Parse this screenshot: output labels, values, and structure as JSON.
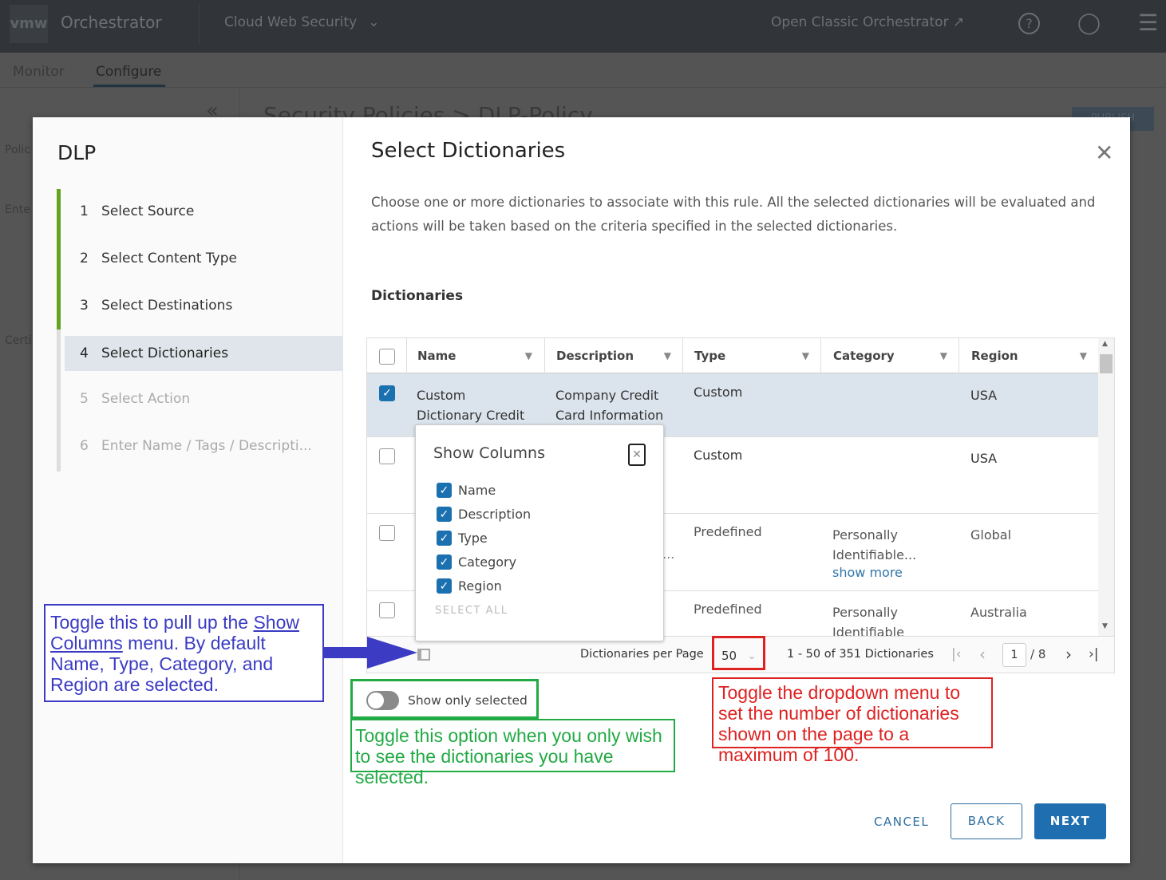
{
  "topbar": {
    "logo": "vmw",
    "app": "Orchestrator",
    "product": "Cloud Web Security",
    "classic": "Open Classic Orchestrator"
  },
  "subnav": {
    "tabs": [
      "Monitor",
      "Configure"
    ],
    "active": "Configure"
  },
  "background": {
    "breadcrumb": "Security Policies > DLP-Policy",
    "publish": "PUBLISH",
    "side_labels": [
      "Polic",
      "Ente",
      "Certi"
    ]
  },
  "wizard": {
    "title": "DLP",
    "steps": [
      {
        "num": "1",
        "label": "Select Source",
        "state": "done"
      },
      {
        "num": "2",
        "label": "Select Content Type",
        "state": "done"
      },
      {
        "num": "3",
        "label": "Select Destinations",
        "state": "done"
      },
      {
        "num": "4",
        "label": "Select Dictionaries",
        "state": "active"
      },
      {
        "num": "5",
        "label": "Select Action",
        "state": "disabled"
      },
      {
        "num": "6",
        "label": "Enter Name / Tags / Descripti...",
        "state": "disabled"
      }
    ]
  },
  "main": {
    "title": "Select Dictionaries",
    "desc1": "Choose one or more dictionaries to associate with this rule. All the selected dictionaries will be evaluated and",
    "desc2": "actions will be taken based on the criteria specified in the selected dictionaries.",
    "section": "Dictionaries"
  },
  "table": {
    "columns": [
      "Name",
      "Description",
      "Type",
      "Category",
      "Region"
    ],
    "rows": [
      {
        "selected": true,
        "name": [
          "Custom",
          "Dictionary Credit"
        ],
        "description": [
          "Company Credit",
          "Card Information"
        ],
        "type": "Custom",
        "category": [],
        "region": "USA"
      },
      {
        "selected": false,
        "name": [],
        "description": [],
        "type": "Custom",
        "category": [],
        "region": "USA"
      },
      {
        "selected": false,
        "name": [],
        "description": [
          "..."
        ],
        "type": "Predefined",
        "category": [
          "Personally",
          "Identifiable..."
        ],
        "show_more": "show more",
        "region": "Global"
      },
      {
        "selected": false,
        "name": [],
        "description": [],
        "type": "Predefined",
        "category": [
          "Personally",
          "Identifiable"
        ],
        "region": "Australia"
      }
    ]
  },
  "show_columns": {
    "title": "Show Columns",
    "items": [
      {
        "label": "Name",
        "checked": true
      },
      {
        "label": "Description",
        "checked": true
      },
      {
        "label": "Type",
        "checked": true
      },
      {
        "label": "Category",
        "checked": true
      },
      {
        "label": "Region",
        "checked": true
      }
    ],
    "select_all": "SELECT ALL"
  },
  "footer": {
    "per_page_label": "Dictionaries per Page",
    "per_page": "50",
    "range": "1 - 50 of 351 Dictionaries",
    "page": "1",
    "total_pages": "/ 8"
  },
  "toggle": {
    "label": "Show only selected",
    "on": false
  },
  "buttons": {
    "cancel": "CANCEL",
    "back": "BACK",
    "next": "NEXT"
  },
  "annotations": {
    "blue": {
      "pre": "Toggle this to pull up the ",
      "link1": "Show",
      "link2": "Columns",
      "post": " menu. By default Name, Type, Category, and Region are selected.",
      "color": "#3b3bc4"
    },
    "green": {
      "text": "Toggle this option when you only wish to see the dictionaries you have selected.",
      "color": "#22aa44"
    },
    "red": {
      "text": "Toggle the dropdown menu to set the number of dictionaries shown on the page to a maximum of 100.",
      "color": "#dd2222"
    }
  },
  "colors": {
    "accent": "#1b70b0",
    "progress": "#62a420"
  }
}
